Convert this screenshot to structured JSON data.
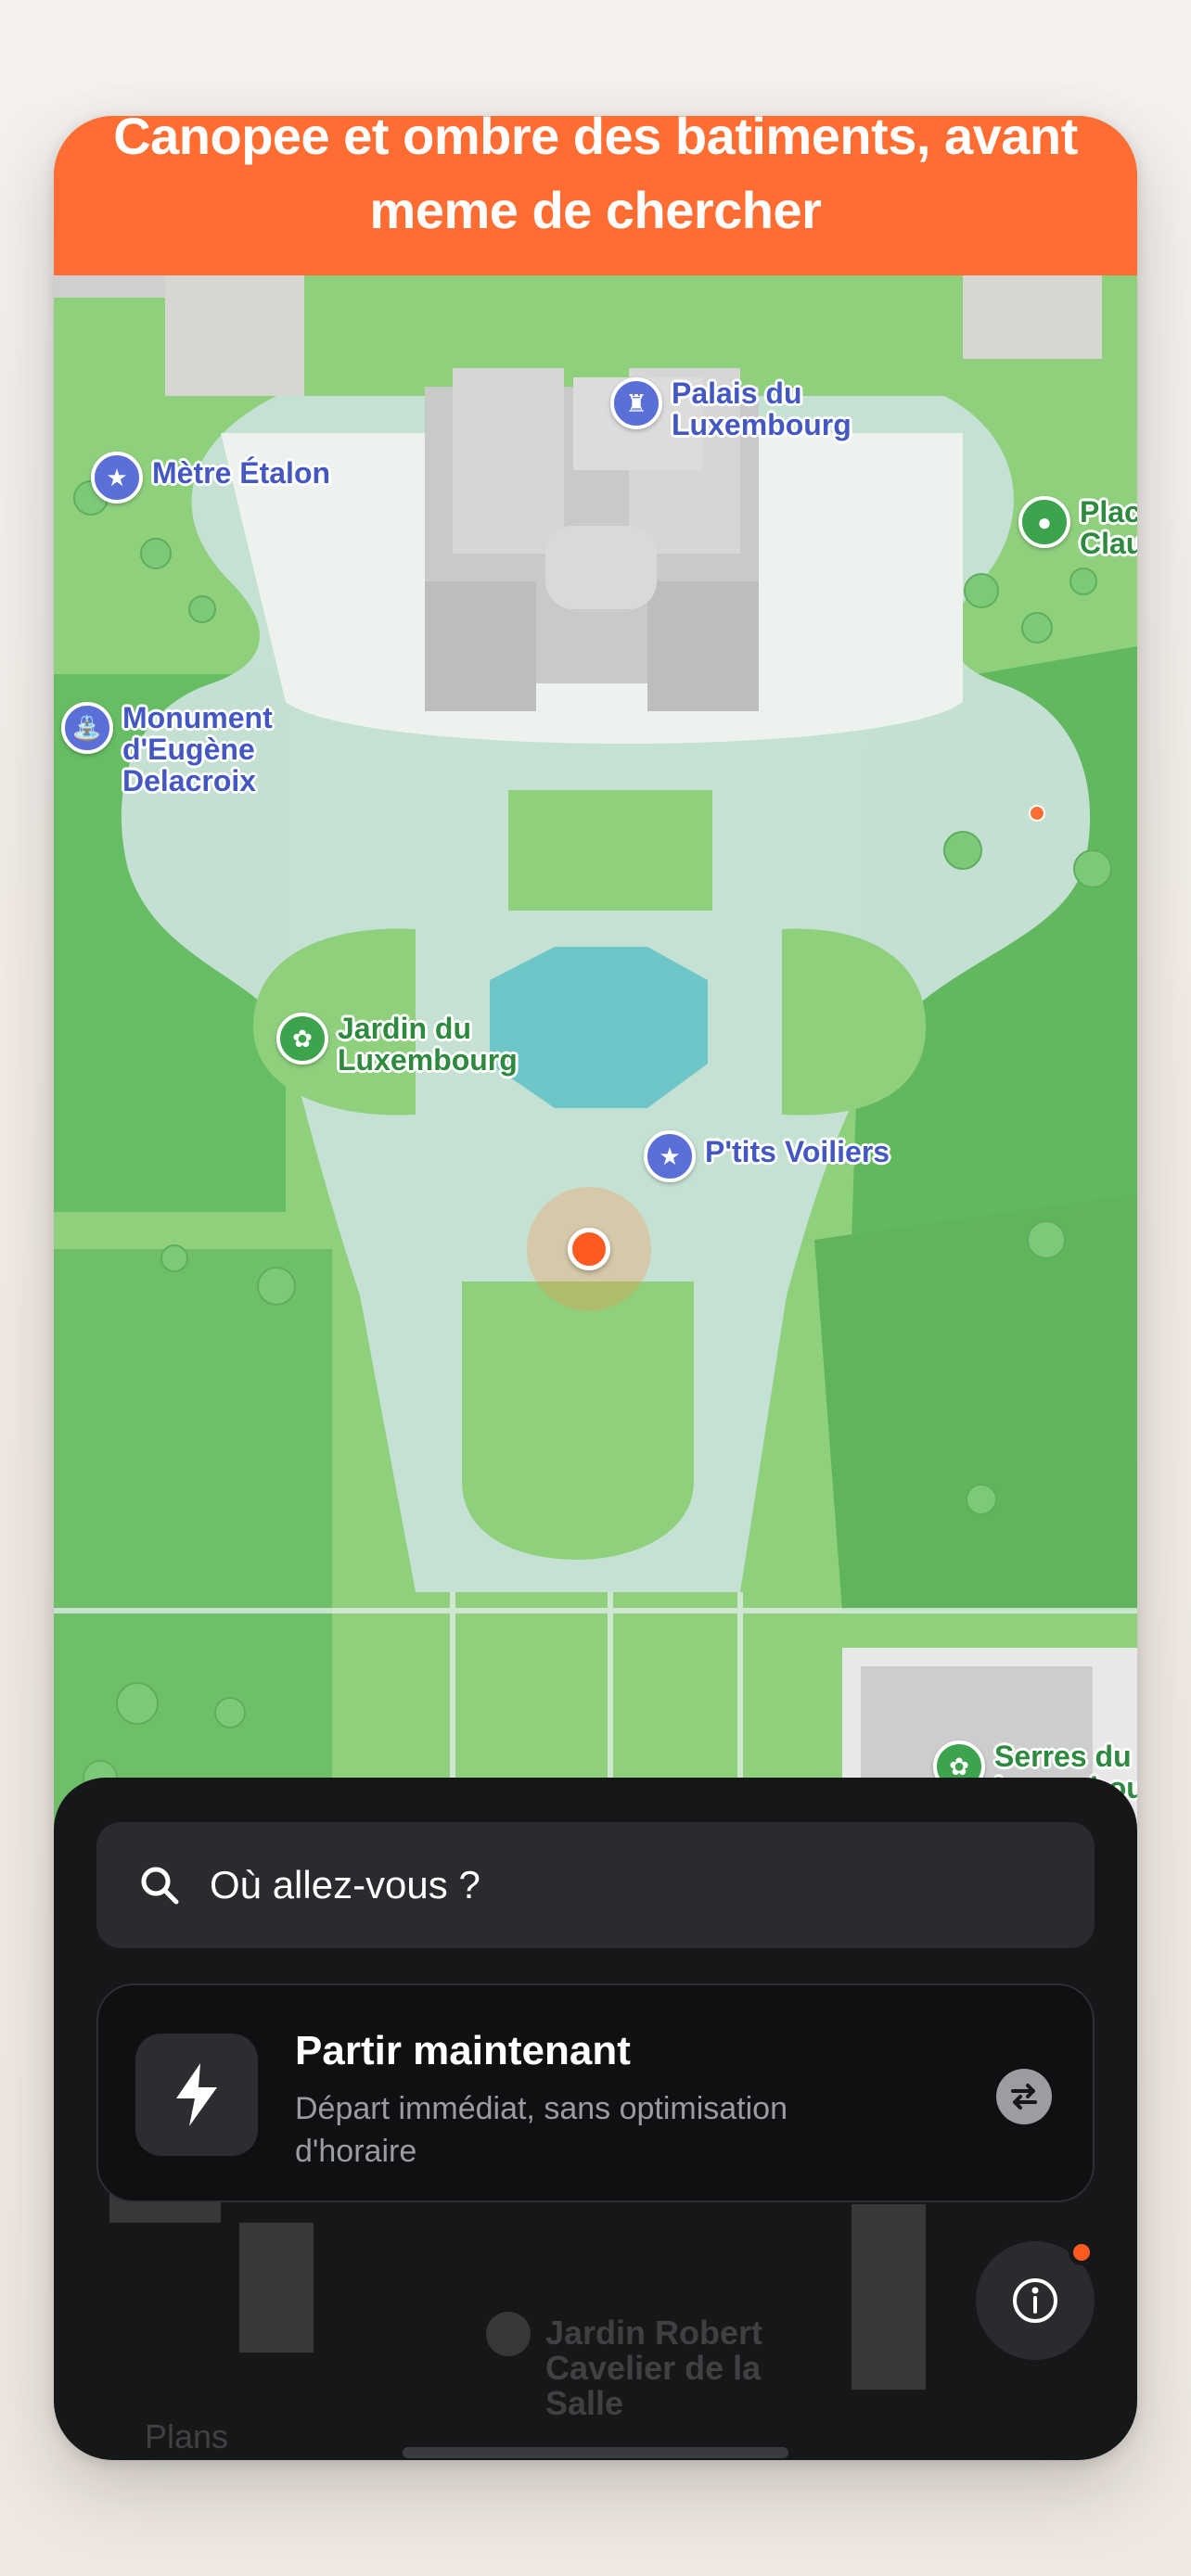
{
  "banner": {
    "title": "Canopee et ombre des batiments, avant meme de chercher"
  },
  "map": {
    "pois": [
      {
        "id": "metre-etalon",
        "label": "Mètre Étalon",
        "icon": "star-icon",
        "color": "#5b6fd8"
      },
      {
        "id": "palais",
        "label": "Palais du Luxembourg",
        "icon": "castle-icon",
        "color": "#5b6fd8"
      },
      {
        "id": "place-claudel",
        "label": "Place Claudel",
        "icon": "pin-icon",
        "color": "#3ea34d"
      },
      {
        "id": "monument-delacroix",
        "label": "Monument d'Eugène Delacroix",
        "icon": "fountain-icon",
        "color": "#5b6fd8"
      },
      {
        "id": "jardin-luxembourg",
        "label": "Jardin du Luxembourg",
        "icon": "flower-icon",
        "color": "#3ea34d"
      },
      {
        "id": "ptits-voiliers",
        "label": "P'tits Voiliers",
        "icon": "star-icon",
        "color": "#5b6fd8"
      },
      {
        "id": "serres",
        "label": "Serres du Luxembourg",
        "icon": "flower-icon",
        "color": "#3ea34d"
      }
    ],
    "user_location": "current-location"
  },
  "sheet": {
    "search": {
      "placeholder": "Où allez-vous ?"
    },
    "depart_card": {
      "title": "Partir maintenant",
      "subtitle": "Départ immédiat, sans optimisation d'horaire"
    },
    "ghost": {
      "jardin_robert": "Jardin Robert Cavelier de la Salle",
      "plans": "Plans"
    }
  },
  "colors": {
    "accent": "#ff6d33",
    "sheet_bg": "#161719",
    "park": "#8fcf7e",
    "water": "#6ec6c9"
  }
}
